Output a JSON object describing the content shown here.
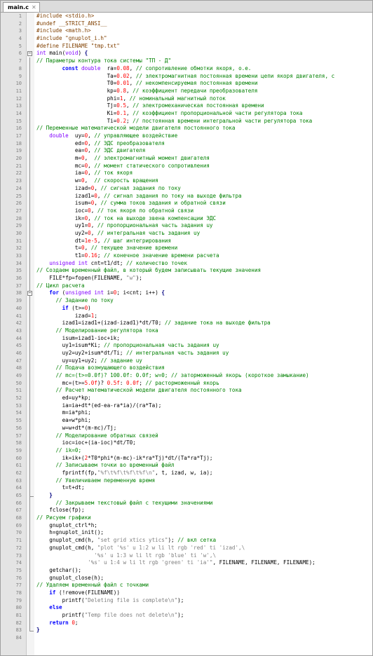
{
  "tab": {
    "title": "main.c",
    "close_glyph": "✕"
  },
  "lines": [
    {
      "n": "1",
      "t": [
        [
          "pre",
          "#include <stdio.h>"
        ]
      ]
    },
    {
      "n": "2",
      "t": [
        [
          "pre",
          "#undef __STRICT_ANSI__"
        ]
      ]
    },
    {
      "n": "3",
      "t": [
        [
          "pre",
          "#include <math.h>"
        ]
      ]
    },
    {
      "n": "4",
      "t": [
        [
          "pre",
          "#include \"gnuplot_i.h\""
        ]
      ]
    },
    {
      "n": "5",
      "t": [
        [
          "pre",
          "#define FILENAME \"tmp.txt\""
        ]
      ]
    },
    {
      "n": "6",
      "fold": "open",
      "t": [
        [
          "ty",
          "int"
        ],
        [
          "id",
          " main("
        ],
        [
          "ty",
          "void"
        ],
        [
          "id",
          ") "
        ],
        [
          "op",
          "{"
        ]
      ]
    },
    {
      "n": "7",
      "t": [
        [
          "cm",
          "// Параметры контура тока системы \"ТП - Д\""
        ]
      ]
    },
    {
      "n": "8",
      "t": [
        [
          "id",
          "        "
        ],
        [
          "kw",
          "const"
        ],
        [
          "id",
          " "
        ],
        [
          "ty",
          "double"
        ],
        [
          "id",
          "  ra="
        ],
        [
          "num",
          "0.08"
        ],
        [
          "id",
          ", "
        ],
        [
          "cm",
          "// сопротивление обмотки якоря, о.е."
        ]
      ]
    },
    {
      "n": "9",
      "t": [
        [
          "id",
          "                      Ta="
        ],
        [
          "num",
          "0.02"
        ],
        [
          "id",
          ", "
        ],
        [
          "cm",
          "// электромагнитная постоянная времени цепи якоря двигателя, с"
        ]
      ]
    },
    {
      "n": "10",
      "t": [
        [
          "id",
          "                      T0="
        ],
        [
          "num",
          "0.01"
        ],
        [
          "id",
          ", "
        ],
        [
          "cm",
          "// некомпенсируемая постоянная времени"
        ]
      ]
    },
    {
      "n": "11",
      "t": [
        [
          "id",
          "                      kp="
        ],
        [
          "num",
          "0.8"
        ],
        [
          "id",
          ", "
        ],
        [
          "cm",
          "// коэффициент передачи преобразователя"
        ]
      ]
    },
    {
      "n": "12",
      "t": [
        [
          "id",
          "                      phi="
        ],
        [
          "num",
          "1"
        ],
        [
          "id",
          ", "
        ],
        [
          "cm",
          "// номинальный магнитный поток"
        ]
      ]
    },
    {
      "n": "13",
      "t": [
        [
          "id",
          "                      Tj="
        ],
        [
          "num",
          "0.5"
        ],
        [
          "id",
          ", "
        ],
        [
          "cm",
          "// электромеханическая постоянная времени"
        ]
      ]
    },
    {
      "n": "14",
      "t": [
        [
          "id",
          "                      Ki="
        ],
        [
          "num",
          "0.1"
        ],
        [
          "id",
          ", "
        ],
        [
          "cm",
          "// коэффициент пропорциональной части регулятора тока"
        ]
      ]
    },
    {
      "n": "15",
      "t": [
        [
          "id",
          "                      Ti="
        ],
        [
          "num",
          "0.2"
        ],
        [
          "id",
          "; "
        ],
        [
          "cm",
          "// постоянная времени интегральной части регулятора тока"
        ]
      ]
    },
    {
      "n": "16",
      "t": [
        [
          "cm",
          "// Переменные математической модели двигателя постоянного тока"
        ]
      ]
    },
    {
      "n": "17",
      "t": [
        [
          "id",
          "    "
        ],
        [
          "ty",
          "double"
        ],
        [
          "id",
          "  uy="
        ],
        [
          "num",
          "0"
        ],
        [
          "id",
          ", "
        ],
        [
          "cm",
          "// управляющее воздействие"
        ]
      ]
    },
    {
      "n": "18",
      "t": [
        [
          "id",
          "            ed="
        ],
        [
          "num",
          "0"
        ],
        [
          "id",
          ", "
        ],
        [
          "cm",
          "// ЭДС преобразователя"
        ]
      ]
    },
    {
      "n": "19",
      "t": [
        [
          "id",
          "            ea="
        ],
        [
          "num",
          "0"
        ],
        [
          "id",
          ", "
        ],
        [
          "cm",
          "// ЭДС двигателя"
        ]
      ]
    },
    {
      "n": "20",
      "t": [
        [
          "id",
          "            m="
        ],
        [
          "num",
          "0"
        ],
        [
          "id",
          ",  "
        ],
        [
          "cm",
          "// электромагнитный момент двигателя"
        ]
      ]
    },
    {
      "n": "21",
      "t": [
        [
          "id",
          "            mc="
        ],
        [
          "num",
          "0"
        ],
        [
          "id",
          ", "
        ],
        [
          "cm",
          "// момент статического сопротивления"
        ]
      ]
    },
    {
      "n": "22",
      "t": [
        [
          "id",
          "            ia="
        ],
        [
          "num",
          "0"
        ],
        [
          "id",
          ", "
        ],
        [
          "cm",
          "// ток якоря"
        ]
      ]
    },
    {
      "n": "23",
      "t": [
        [
          "id",
          "            w="
        ],
        [
          "num",
          "0"
        ],
        [
          "id",
          ",  "
        ],
        [
          "cm",
          "// скорость вращения"
        ]
      ]
    },
    {
      "n": "24",
      "t": [
        [
          "id",
          "            izad="
        ],
        [
          "num",
          "0"
        ],
        [
          "id",
          ", "
        ],
        [
          "cm",
          "// сигнал задания по току"
        ]
      ]
    },
    {
      "n": "25",
      "t": [
        [
          "id",
          "            izad1="
        ],
        [
          "num",
          "0"
        ],
        [
          "id",
          ", "
        ],
        [
          "cm",
          "// сигнал задания по току на выходе фильтра"
        ]
      ]
    },
    {
      "n": "26",
      "t": [
        [
          "id",
          "            isum="
        ],
        [
          "num",
          "0"
        ],
        [
          "id",
          ", "
        ],
        [
          "cm",
          "// сумма токов задания и обратной связи"
        ]
      ]
    },
    {
      "n": "27",
      "t": [
        [
          "id",
          "            ioc="
        ],
        [
          "num",
          "0"
        ],
        [
          "id",
          ", "
        ],
        [
          "cm",
          "// ток якоря по обратной связи"
        ]
      ]
    },
    {
      "n": "28",
      "t": [
        [
          "id",
          "            ik="
        ],
        [
          "num",
          "0"
        ],
        [
          "id",
          ", "
        ],
        [
          "cm",
          "// ток на выходе звена компенсации ЭДС"
        ]
      ]
    },
    {
      "n": "29",
      "t": [
        [
          "id",
          "            uy1="
        ],
        [
          "num",
          "0"
        ],
        [
          "id",
          ", "
        ],
        [
          "cm",
          "// пропорциональная часть задания uy"
        ]
      ]
    },
    {
      "n": "30",
      "t": [
        [
          "id",
          "            uy2="
        ],
        [
          "num",
          "0"
        ],
        [
          "id",
          ", "
        ],
        [
          "cm",
          "// интегральная часть задания uy"
        ]
      ]
    },
    {
      "n": "31",
      "t": [
        [
          "id",
          "            dt="
        ],
        [
          "num",
          "1e-5"
        ],
        [
          "id",
          ", "
        ],
        [
          "cm",
          "// шаг интегрирования"
        ]
      ]
    },
    {
      "n": "32",
      "t": [
        [
          "id",
          "            t="
        ],
        [
          "num",
          "0"
        ],
        [
          "id",
          ", "
        ],
        [
          "cm",
          "// текущее значение времени"
        ]
      ]
    },
    {
      "n": "33",
      "t": [
        [
          "id",
          "            t1="
        ],
        [
          "num",
          "0.16"
        ],
        [
          "id",
          "; "
        ],
        [
          "cm",
          "// конечное значение времени расчета"
        ]
      ]
    },
    {
      "n": "34",
      "t": [
        [
          "id",
          "    "
        ],
        [
          "ty",
          "unsigned int"
        ],
        [
          "id",
          " cnt=t1/dt; "
        ],
        [
          "cm",
          "// количество точек"
        ]
      ]
    },
    {
      "n": "35",
      "t": [
        [
          "cm",
          "// Создаем временный файл, в который будем записывать текущие значения"
        ]
      ]
    },
    {
      "n": "36",
      "t": [
        [
          "id",
          "    FILE*fp=fopen(FILENAME, "
        ],
        [
          "str",
          "\"w\""
        ],
        [
          "id",
          ");"
        ]
      ]
    },
    {
      "n": "37",
      "t": [
        [
          "cm",
          "// Цикл расчета"
        ]
      ]
    },
    {
      "n": "38",
      "fold": "open",
      "t": [
        [
          "id",
          "    "
        ],
        [
          "kw",
          "for"
        ],
        [
          "id",
          " ("
        ],
        [
          "ty",
          "unsigned int"
        ],
        [
          "id",
          " i="
        ],
        [
          "num",
          "0"
        ],
        [
          "id",
          "; i<cnt; i++) "
        ],
        [
          "op",
          "{"
        ]
      ]
    },
    {
      "n": "39",
      "t": [
        [
          "id",
          "      "
        ],
        [
          "cm",
          "// Задание по току"
        ]
      ]
    },
    {
      "n": "40",
      "t": [
        [
          "id",
          "        "
        ],
        [
          "kw",
          "if"
        ],
        [
          "id",
          " (t>="
        ],
        [
          "num",
          "0"
        ],
        [
          "id",
          ")"
        ]
      ]
    },
    {
      "n": "41",
      "t": [
        [
          "id",
          "            izad="
        ],
        [
          "num",
          "1"
        ],
        [
          "id",
          ";"
        ]
      ]
    },
    {
      "n": "42",
      "t": [
        [
          "id",
          "        izad1=izad1+(izad-izad1)*dt/T0; "
        ],
        [
          "cm",
          "// задание тока на выходе фильтра"
        ]
      ]
    },
    {
      "n": "43",
      "t": [
        [
          "id",
          "      "
        ],
        [
          "cm",
          "// Моделирование регулятора тока"
        ]
      ]
    },
    {
      "n": "44",
      "t": [
        [
          "id",
          "        isum=izad1-ioc+ik;"
        ]
      ]
    },
    {
      "n": "45",
      "t": [
        [
          "id",
          "        uy1=isum*Ki; "
        ],
        [
          "cm",
          "// пропорциональная часть задания uy"
        ]
      ]
    },
    {
      "n": "46",
      "t": [
        [
          "id",
          "        uy2=uy2+isum*dt/Ti; "
        ],
        [
          "cm",
          "// интегральная часть задания uy"
        ]
      ]
    },
    {
      "n": "47",
      "t": [
        [
          "id",
          "        uy=uy1+uy2; "
        ],
        [
          "cm",
          "// задание uy"
        ]
      ]
    },
    {
      "n": "48",
      "t": [
        [
          "id",
          "      "
        ],
        [
          "cm",
          "// Подача возмущающего воздействия"
        ]
      ]
    },
    {
      "n": "49",
      "t": [
        [
          "id",
          "      "
        ],
        [
          "cm",
          "// mc=(t>=0.0f)? 100.0f: 0.0f; w=0; // заторможенный якорь (короткое замыкание)"
        ]
      ]
    },
    {
      "n": "50",
      "t": [
        [
          "id",
          "        mc=(t>="
        ],
        [
          "num",
          "5.0f"
        ],
        [
          "id",
          ")? "
        ],
        [
          "num",
          "0.5f"
        ],
        [
          "id",
          ": "
        ],
        [
          "num",
          "0.0f"
        ],
        [
          "id",
          "; "
        ],
        [
          "cm",
          "// расторможенный якорь"
        ]
      ]
    },
    {
      "n": "51",
      "t": [
        [
          "id",
          "      "
        ],
        [
          "cm",
          "// Расчет математической модели двигателя постоянного тока"
        ]
      ]
    },
    {
      "n": "52",
      "t": [
        [
          "id",
          "        ed=uy*kp;"
        ]
      ]
    },
    {
      "n": "53",
      "t": [
        [
          "id",
          "        ia=ia+dt*(ed-ea-ra*ia)/(ra*Ta);"
        ]
      ]
    },
    {
      "n": "54",
      "t": [
        [
          "id",
          "        m=ia*phi;"
        ]
      ]
    },
    {
      "n": "55",
      "t": [
        [
          "id",
          "        ea=w*phi;"
        ]
      ]
    },
    {
      "n": "56",
      "t": [
        [
          "id",
          "        w=w+dt*(m-mc)/Tj;"
        ]
      ]
    },
    {
      "n": "57",
      "t": [
        [
          "id",
          "      "
        ],
        [
          "cm",
          "// Моделирование обратных связей"
        ]
      ]
    },
    {
      "n": "58",
      "t": [
        [
          "id",
          "        ioc=ioc+(ia-ioc)*dt/T0;"
        ]
      ]
    },
    {
      "n": "59",
      "t": [
        [
          "id",
          "      "
        ],
        [
          "cm",
          "// ik=0;"
        ]
      ]
    },
    {
      "n": "60",
      "t": [
        [
          "id",
          "        ik=ik+("
        ],
        [
          "num",
          "2"
        ],
        [
          "id",
          "*T0*phi*(m-mc)-ik*ra*Tj)*dt/(Ta*ra*Tj);"
        ]
      ]
    },
    {
      "n": "61",
      "t": [
        [
          "id",
          "      "
        ],
        [
          "cm",
          "// Записываем точки во временный файл"
        ]
      ]
    },
    {
      "n": "62",
      "t": [
        [
          "id",
          "        fprintf(fp,"
        ],
        [
          "str",
          "\"%f\\t%f\\t%f\\t%f\\n\""
        ],
        [
          "id",
          ", t, izad, w, ia);"
        ]
      ]
    },
    {
      "n": "63",
      "t": [
        [
          "id",
          "      "
        ],
        [
          "cm",
          "// Увеличиваем переменную время"
        ]
      ]
    },
    {
      "n": "64",
      "t": [
        [
          "id",
          "        t=t+dt;"
        ]
      ]
    },
    {
      "n": "65",
      "foldend": true,
      "t": [
        [
          "id",
          "    "
        ],
        [
          "op",
          "}"
        ]
      ]
    },
    {
      "n": "66",
      "t": [
        [
          "id",
          "      "
        ],
        [
          "cm",
          "// Закрываем текстовый файл с текущими значениями"
        ]
      ]
    },
    {
      "n": "67",
      "t": [
        [
          "id",
          "    fclose(fp);"
        ]
      ]
    },
    {
      "n": "68",
      "t": [
        [
          "cm",
          "// Рисуем графики"
        ]
      ]
    },
    {
      "n": "69",
      "t": [
        [
          "id",
          "    gnuplot_ctrl*h;"
        ]
      ]
    },
    {
      "n": "70",
      "t": [
        [
          "id",
          "    h=gnuplot_init();"
        ]
      ]
    },
    {
      "n": "71",
      "t": [
        [
          "id",
          "    gnuplot_cmd(h, "
        ],
        [
          "str",
          "\"set grid xtics ytics\""
        ],
        [
          "id",
          "); "
        ],
        [
          "cm",
          "// вкл сетка"
        ]
      ]
    },
    {
      "n": "72",
      "t": [
        [
          "id",
          "    gnuplot_cmd(h, "
        ],
        [
          "str",
          "\"plot '%s' u 1:2 w li lt rgb 'red' ti 'izad',\\"
        ]
      ]
    },
    {
      "n": "73",
      "t": [
        [
          "str",
          "                  '%s' u 1:3 w li lt rgb 'blue' ti 'w',\\"
        ]
      ]
    },
    {
      "n": "74",
      "t": [
        [
          "str",
          "                '%s' u 1:4 w li lt rgb 'green' ti 'ia'\""
        ],
        [
          "id",
          ", FILENAME, FILENAME, FILENAME);"
        ]
      ]
    },
    {
      "n": "75",
      "t": [
        [
          "id",
          "    getchar();"
        ]
      ]
    },
    {
      "n": "76",
      "t": [
        [
          "id",
          "    gnuplot_close(h);"
        ]
      ]
    },
    {
      "n": "77",
      "t": [
        [
          "cm",
          "// Удаляем временный файл с точками"
        ]
      ]
    },
    {
      "n": "78",
      "t": [
        [
          "id",
          "    "
        ],
        [
          "kw",
          "if"
        ],
        [
          "id",
          " (!remove(FILENAME))"
        ]
      ]
    },
    {
      "n": "79",
      "t": [
        [
          "id",
          "        printf("
        ],
        [
          "str",
          "\"Deleting file is complete\\n\""
        ],
        [
          "id",
          ");"
        ]
      ]
    },
    {
      "n": "80",
      "t": [
        [
          "id",
          "    "
        ],
        [
          "kw",
          "else"
        ]
      ]
    },
    {
      "n": "81",
      "t": [
        [
          "id",
          "        printf("
        ],
        [
          "str",
          "\"Temp file does not delete\\n\""
        ],
        [
          "id",
          ");"
        ]
      ]
    },
    {
      "n": "82",
      "t": [
        [
          "id",
          "    "
        ],
        [
          "kw",
          "return"
        ],
        [
          "id",
          " "
        ],
        [
          "num",
          "0"
        ],
        [
          "id",
          ";"
        ]
      ]
    },
    {
      "n": "83",
      "foldend": true,
      "t": [
        [
          "op",
          "}"
        ]
      ]
    },
    {
      "n": "84",
      "t": []
    }
  ],
  "colors": {
    "preprocessor": "#804000",
    "keyword": "#0000ff",
    "type": "#8000ff",
    "number": "#ff0000",
    "string": "#808080",
    "comment": "#008000"
  }
}
